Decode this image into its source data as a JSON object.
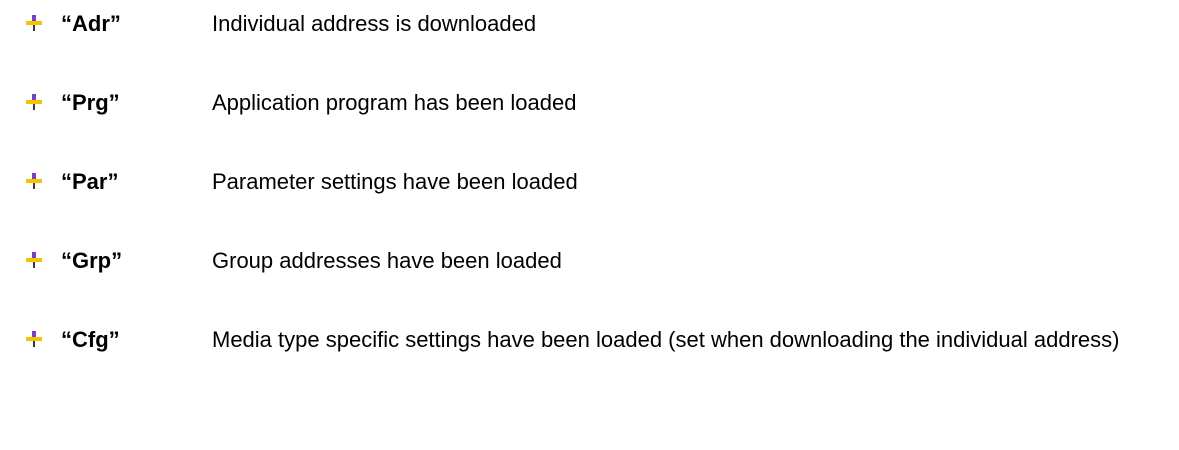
{
  "items": [
    {
      "code": "“Adr”",
      "description": "Individual address is downloaded",
      "icon": "pushpin-bullet-icon"
    },
    {
      "code": "“Prg”",
      "description": "Application program has been loaded",
      "icon": "pushpin-bullet-icon"
    },
    {
      "code": "“Par”",
      "description": "Parameter settings have been loaded",
      "icon": "pushpin-bullet-icon"
    },
    {
      "code": "“Grp”",
      "description": "Group addresses have been loaded",
      "icon": "pushpin-bullet-icon"
    },
    {
      "code": "“Cfg”",
      "description": "Media type specific settings have been loaded (set when downloading the individual address)",
      "icon": "pushpin-bullet-icon"
    }
  ],
  "colors": {
    "bullet_top": "#7a3fc7",
    "bullet_bar": "#f5c400",
    "bullet_stem": "#3a3a3a",
    "text": "#000000"
  }
}
